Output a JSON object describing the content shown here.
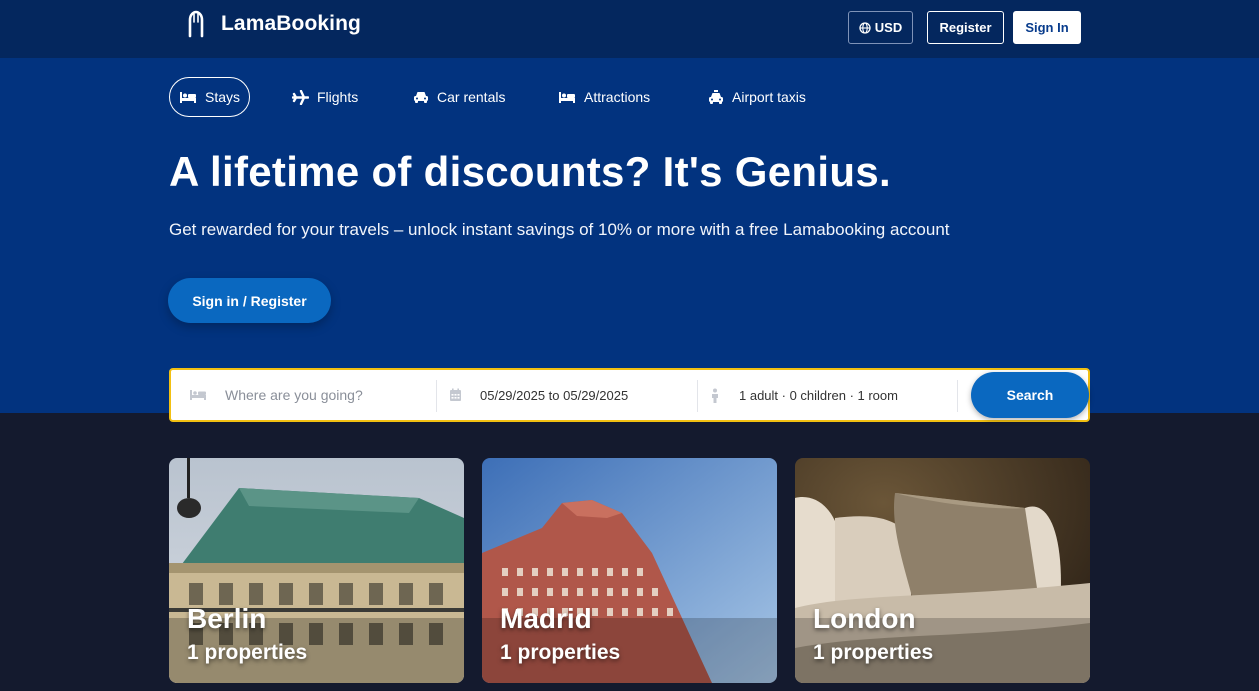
{
  "header": {
    "logo_text": "LamaBooking",
    "currency_label": "USD",
    "register_label": "Register",
    "signin_label": "Sign In"
  },
  "nav": {
    "items": [
      {
        "label": "Stays",
        "icon": "bed-icon",
        "active": true
      },
      {
        "label": "Flights",
        "icon": "plane-icon"
      },
      {
        "label": "Car rentals",
        "icon": "car-icon"
      },
      {
        "label": "Attractions",
        "icon": "bed-icon"
      },
      {
        "label": "Airport taxis",
        "icon": "taxi-icon"
      }
    ]
  },
  "hero": {
    "title": "A lifetime of discounts? It's Genius.",
    "subtitle": "Get rewarded for your travels – unlock instant savings of 10% or more with a free Lamabooking account",
    "cta_label": "Sign in / Register"
  },
  "search": {
    "destination_placeholder": "Where are you going?",
    "destination_value": "",
    "date_range": "05/29/2025 to 05/29/2025",
    "occupancy": "1 adult · 0 children · 1 room",
    "button_label": "Search"
  },
  "cities": [
    {
      "name": "Berlin",
      "properties": "1 properties"
    },
    {
      "name": "Madrid",
      "properties": "1 properties"
    },
    {
      "name": "London",
      "properties": "1 properties"
    }
  ],
  "colors": {
    "header_bg": "#04275e",
    "hero_bg": "#02337f",
    "page_bg": "#141a2e",
    "accent_blue": "#0a68c0",
    "search_border": "#f2c012"
  }
}
